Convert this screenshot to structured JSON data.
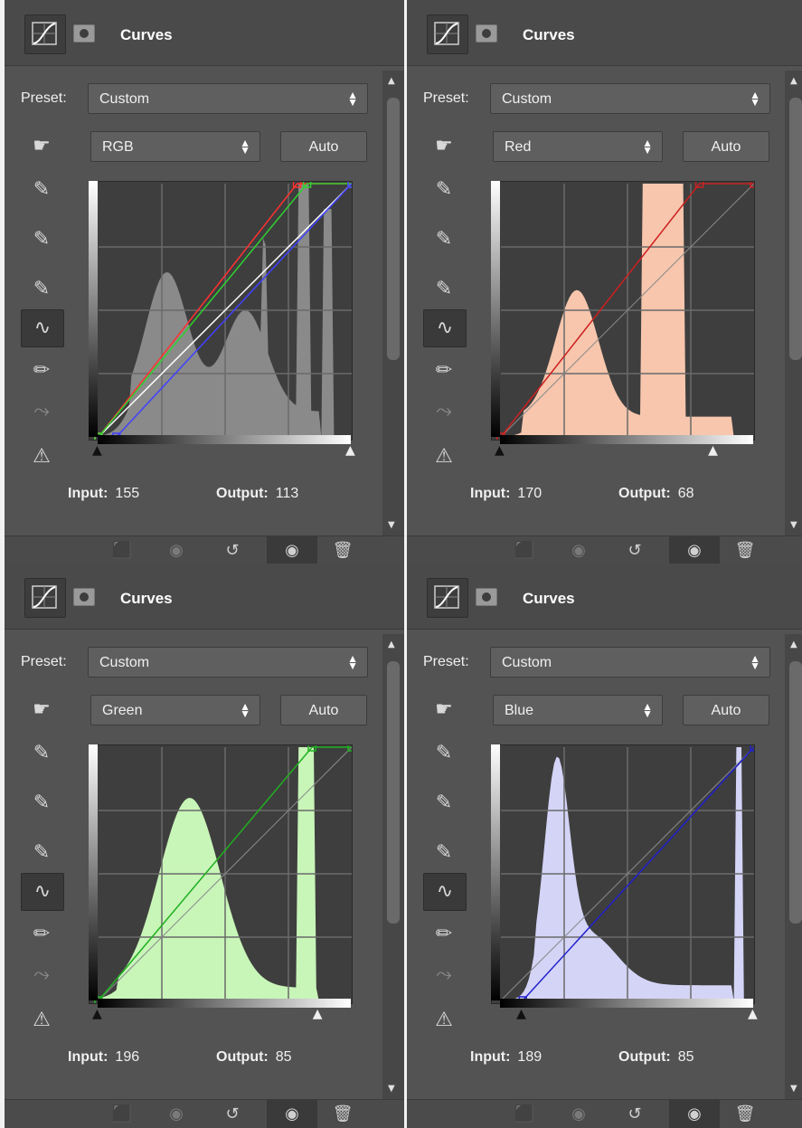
{
  "panels": [
    {
      "title": "Curves",
      "preset_label": "Preset:",
      "preset_value": "Custom",
      "channel": "RGB",
      "auto_label": "Auto",
      "input_label": "Input:",
      "input_value": "155",
      "output_label": "Output:",
      "output_value": "113",
      "hist_color": "#8a8a8a"
    },
    {
      "title": "Curves",
      "preset_label": "Preset:",
      "preset_value": "Custom",
      "channel": "Red",
      "auto_label": "Auto",
      "input_label": "Input:",
      "input_value": "170",
      "output_label": "Output:",
      "output_value": "68",
      "hist_color": "#f7c6ad"
    },
    {
      "title": "Curves",
      "preset_label": "Preset:",
      "preset_value": "Custom",
      "channel": "Green",
      "auto_label": "Auto",
      "input_label": "Input:",
      "input_value": "196",
      "output_label": "Output:",
      "output_value": "85",
      "hist_color": "#c8f5b8"
    },
    {
      "title": "Curves",
      "preset_label": "Preset:",
      "preset_value": "Custom",
      "channel": "Blue",
      "auto_label": "Auto",
      "input_label": "Input:",
      "input_value": "189",
      "output_label": "Output:",
      "output_value": "85",
      "hist_color": "#d4d4f7"
    }
  ],
  "icons": {
    "header_curves": "curves-adjustment-icon",
    "header_mask": "layer-mask-icon",
    "on_image_adjust": "on-image-adjust-icon",
    "eyedropper_black": "eyedropper-black-icon",
    "eyedropper_gray": "eyedropper-gray-icon",
    "eyedropper_white": "eyedropper-white-icon",
    "curve_points": "curve-points-icon",
    "pencil": "pencil-icon",
    "smooth": "smooth-icon",
    "clipping_warning": "clipping-warning-icon",
    "clip_to_layer": "clip-to-layer-icon",
    "view_previous": "view-previous-icon",
    "reset": "reset-icon",
    "visibility": "visibility-icon",
    "delete": "delete-icon"
  }
}
